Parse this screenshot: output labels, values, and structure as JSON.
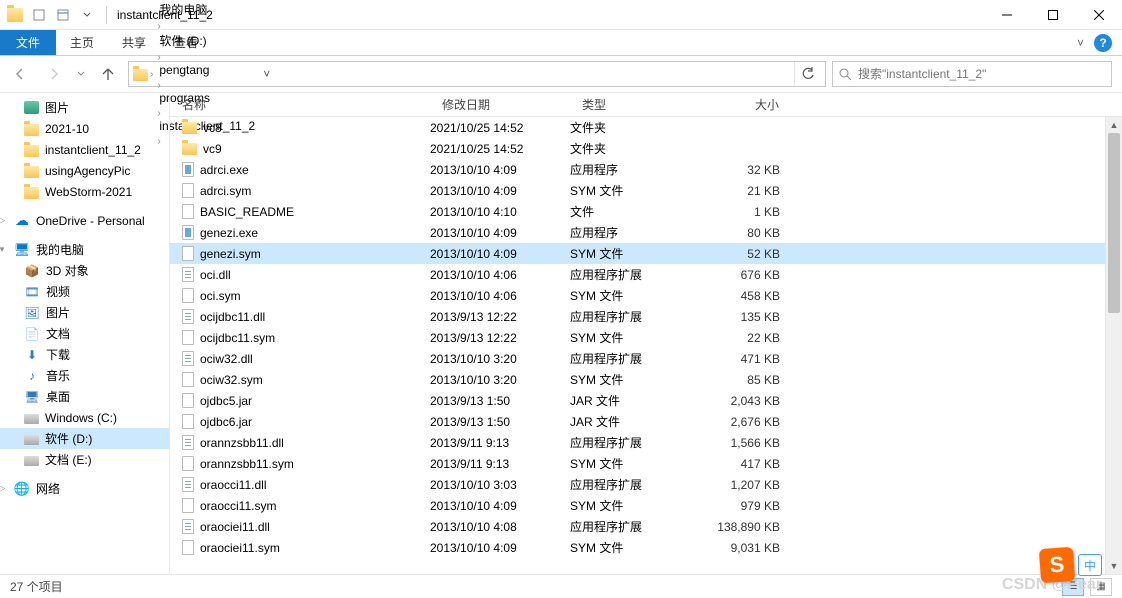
{
  "window": {
    "title": "instantclient_11_2"
  },
  "ribbon": {
    "file": "文件",
    "home": "主页",
    "share": "共享",
    "view": "查看"
  },
  "breadcrumb": {
    "items": [
      "我的电脑",
      "软件 (D:)",
      "pengtang",
      "programs",
      "instantclient_11_2"
    ]
  },
  "search": {
    "placeholder": "搜索\"instantclient_11_2\""
  },
  "nav": {
    "quick": [
      {
        "label": "图片",
        "icon": "pictures"
      },
      {
        "label": "2021-10",
        "icon": "folder"
      },
      {
        "label": "instantclient_11_2",
        "icon": "folder"
      },
      {
        "label": "usingAgencyPic",
        "icon": "folder-check"
      },
      {
        "label": "WebStorm-2021",
        "icon": "folder"
      }
    ],
    "onedrive": "OneDrive - Personal",
    "thispc": "我的电脑",
    "pc_items": [
      {
        "label": "3D 对象",
        "icon": "pc-3d"
      },
      {
        "label": "视频",
        "icon": "pc-video"
      },
      {
        "label": "图片",
        "icon": "pc-pic"
      },
      {
        "label": "文档",
        "icon": "pc-doc"
      },
      {
        "label": "下载",
        "icon": "pc-dl"
      },
      {
        "label": "音乐",
        "icon": "pc-music"
      },
      {
        "label": "桌面",
        "icon": "pc-desk"
      },
      {
        "label": "Windows (C:)",
        "icon": "disk"
      },
      {
        "label": "软件 (D:)",
        "icon": "disk",
        "selected": true
      },
      {
        "label": "文档 (E:)",
        "icon": "disk"
      }
    ],
    "network": "网络"
  },
  "columns": {
    "name": "名称",
    "date": "修改日期",
    "type": "类型",
    "size": "大小"
  },
  "files": [
    {
      "name": "vc8",
      "date": "2021/10/25 14:52",
      "type": "文件夹",
      "size": "",
      "icon": "folder"
    },
    {
      "name": "vc9",
      "date": "2021/10/25 14:52",
      "type": "文件夹",
      "size": "",
      "icon": "folder"
    },
    {
      "name": "adrci.exe",
      "date": "2013/10/10 4:09",
      "type": "应用程序",
      "size": "32 KB",
      "icon": "exe"
    },
    {
      "name": "adrci.sym",
      "date": "2013/10/10 4:09",
      "type": "SYM 文件",
      "size": "21 KB",
      "icon": "sym"
    },
    {
      "name": "BASIC_README",
      "date": "2013/10/10 4:10",
      "type": "文件",
      "size": "1 KB",
      "icon": "file"
    },
    {
      "name": "genezi.exe",
      "date": "2013/10/10 4:09",
      "type": "应用程序",
      "size": "80 KB",
      "icon": "exe"
    },
    {
      "name": "genezi.sym",
      "date": "2013/10/10 4:09",
      "type": "SYM 文件",
      "size": "52 KB",
      "icon": "sym",
      "selected": true
    },
    {
      "name": "oci.dll",
      "date": "2013/10/10 4:06",
      "type": "应用程序扩展",
      "size": "676 KB",
      "icon": "dll"
    },
    {
      "name": "oci.sym",
      "date": "2013/10/10 4:06",
      "type": "SYM 文件",
      "size": "458 KB",
      "icon": "sym"
    },
    {
      "name": "ocijdbc11.dll",
      "date": "2013/9/13 12:22",
      "type": "应用程序扩展",
      "size": "135 KB",
      "icon": "dll"
    },
    {
      "name": "ocijdbc11.sym",
      "date": "2013/9/13 12:22",
      "type": "SYM 文件",
      "size": "22 KB",
      "icon": "sym"
    },
    {
      "name": "ociw32.dll",
      "date": "2013/10/10 3:20",
      "type": "应用程序扩展",
      "size": "471 KB",
      "icon": "dll"
    },
    {
      "name": "ociw32.sym",
      "date": "2013/10/10 3:20",
      "type": "SYM 文件",
      "size": "85 KB",
      "icon": "sym"
    },
    {
      "name": "ojdbc5.jar",
      "date": "2013/9/13 1:50",
      "type": "JAR 文件",
      "size": "2,043 KB",
      "icon": "jar"
    },
    {
      "name": "ojdbc6.jar",
      "date": "2013/9/13 1:50",
      "type": "JAR 文件",
      "size": "2,676 KB",
      "icon": "jar"
    },
    {
      "name": "orannzsbb11.dll",
      "date": "2013/9/11 9:13",
      "type": "应用程序扩展",
      "size": "1,566 KB",
      "icon": "dll"
    },
    {
      "name": "orannzsbb11.sym",
      "date": "2013/9/11 9:13",
      "type": "SYM 文件",
      "size": "417 KB",
      "icon": "sym"
    },
    {
      "name": "oraocci11.dll",
      "date": "2013/10/10 3:03",
      "type": "应用程序扩展",
      "size": "1,207 KB",
      "icon": "dll"
    },
    {
      "name": "oraocci11.sym",
      "date": "2013/10/10 4:09",
      "type": "SYM 文件",
      "size": "979 KB",
      "icon": "sym"
    },
    {
      "name": "oraociei11.dll",
      "date": "2013/10/10 4:08",
      "type": "应用程序扩展",
      "size": "138,890 KB",
      "icon": "dll"
    },
    {
      "name": "oraociei11.sym",
      "date": "2013/10/10 4:09",
      "type": "SYM 文件",
      "size": "9,031 KB",
      "icon": "sym"
    }
  ],
  "status": {
    "count": "27 个项目"
  },
  "watermark": "CSDN @Pear",
  "sogou_lang": "中"
}
